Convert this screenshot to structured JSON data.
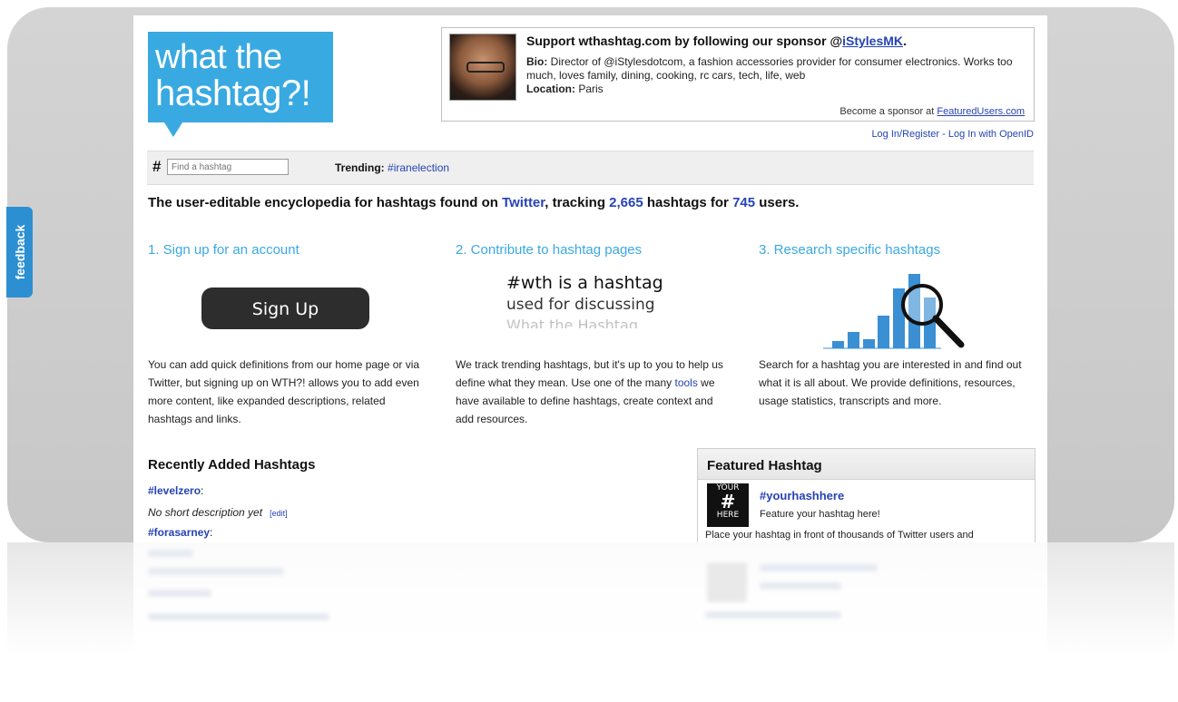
{
  "logo": {
    "line1": "what the",
    "line2": "hashtag?!"
  },
  "sponsor": {
    "title_prefix": "Support wthashtag.com by following our sponsor @",
    "sponsor_handle": "iStylesMK",
    "title_suffix": ".",
    "bio_label": "Bio:",
    "bio_text": "Director of @iStylesdotcom, a fashion accessories provider for consumer electronics. Works too much, loves family, dining, cooking, rc cars, tech, life, web",
    "location_label": "Location:",
    "location_text": "Paris",
    "become_text": "Become a sponsor at ",
    "become_link": "FeaturedUsers.com"
  },
  "auth": {
    "login_register": "Log In/Register",
    "separator": " - ",
    "openid": "Log In with OpenID"
  },
  "search": {
    "hash_symbol": "#",
    "placeholder": "Find a hashtag",
    "trending_label": "Trending:",
    "trending_tag": "#iranelection"
  },
  "tagline": {
    "part1": "The user-editable encyclopedia for hashtags found on ",
    "twitter": "Twitter",
    "part2": ", tracking ",
    "hashtag_count": "2,665",
    "part3": " hashtags for ",
    "user_count": "745",
    "part4": " users."
  },
  "columns": {
    "signup": {
      "heading": "1. Sign up for an account",
      "button": "Sign Up",
      "text": "You can add quick definitions from our home page or via Twitter, but signing up on WTH?! allows you to add even more content, like expanded descriptions, related hashtags and links."
    },
    "contribute": {
      "heading": "2. Contribute to hashtag pages",
      "demo_line1": "#wth is a hashtag",
      "demo_line2": "used for discussing",
      "demo_line3": "What the Hashtag.",
      "text_before": "We track trending hashtags, but it's up to you to help us define what they mean. Use one of the many ",
      "tools_link": "tools",
      "text_after": " we have available to define hashtags, create context and add resources."
    },
    "research": {
      "heading": "3. Research specific hashtags",
      "text": "Search for a hashtag you are interested in and find out what it is all about. We provide definitions, resources, usage statistics, transcripts and more."
    }
  },
  "recent": {
    "heading": "Recently Added Hashtags",
    "items": [
      {
        "tag": "#levelzero",
        "suffix": ":",
        "desc": "No short description yet",
        "edit": "[edit]"
      },
      {
        "tag": "#forasarney",
        "suffix": ":"
      }
    ]
  },
  "featured": {
    "heading": "Featured Hashtag",
    "badge_top": "YOUR",
    "badge_mid": "#",
    "badge_bottom": "HERE",
    "tag": "#yourhashhere",
    "subtitle": "Feature your hashtag here!",
    "long_text": "Place your hashtag in front of thousands of Twitter users and"
  },
  "feedback": {
    "label": "feedback"
  },
  "colors": {
    "brand_blue": "#39a9e1",
    "link_blue": "#2643b5",
    "feedback_blue": "#2c8fd1"
  }
}
